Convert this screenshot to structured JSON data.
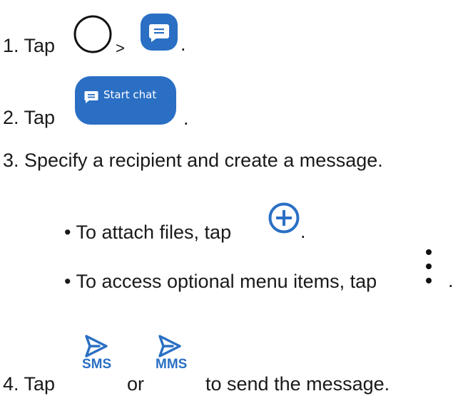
{
  "steps": {
    "step1": {
      "prefix": "1. Tap",
      "separator": ">",
      "end": ".",
      "icons": [
        "home-circle-icon",
        "messages-app-icon"
      ]
    },
    "step2": {
      "prefix": "2. Tap",
      "button_label": "Start chat",
      "end": "."
    },
    "step3": {
      "text": "3. Specify a recipient and create a message."
    },
    "bullet1": {
      "text": "• To attach files, tap",
      "end": ".",
      "icon": "attach-plus-icon"
    },
    "bullet2": {
      "text": "• To access optional menu items, tap",
      "end": ".",
      "icon": "more-options-icon"
    },
    "step4": {
      "prefix": "4. Tap",
      "or": "or",
      "suffix": "to send the message.",
      "sms_label": "SMS",
      "mms_label": "MMS",
      "icon": "send-icon"
    }
  },
  "colors": {
    "accent": "#2a6fc4",
    "text": "#1a1a1a"
  }
}
